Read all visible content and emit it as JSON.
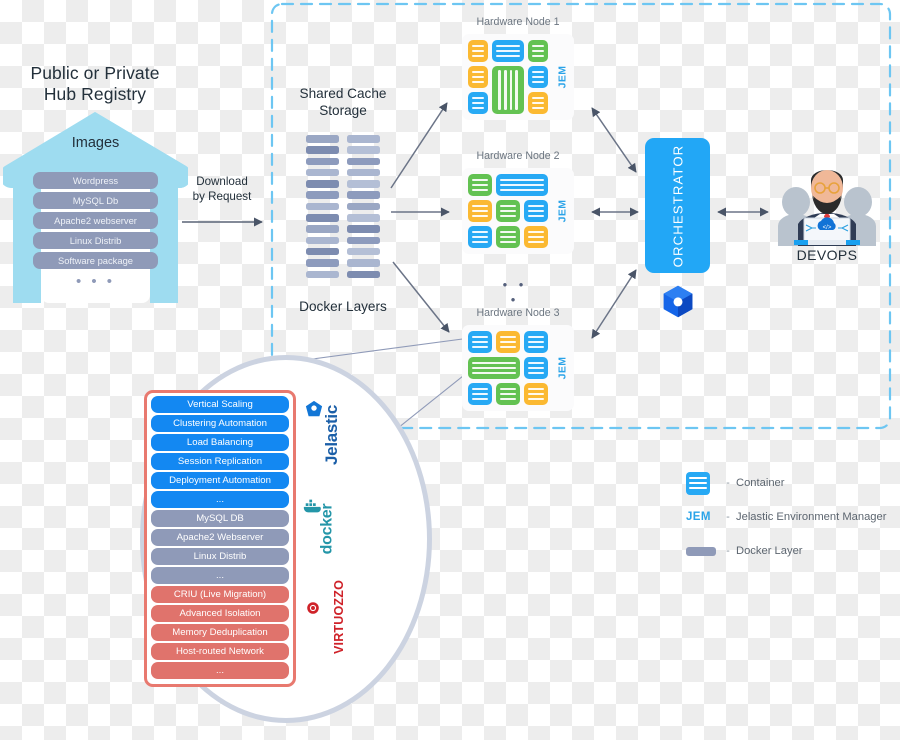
{
  "boundary": {
    "color": "#6dc6f2",
    "style": "dashed-rounded"
  },
  "hub": {
    "title": "Public or Private\nHub Registry",
    "title_line1": "Public or Private",
    "title_line2": "Hub Registry",
    "images_label": "Images",
    "items": [
      "Wordpress",
      "MySQL Db",
      "Apache2 webserver",
      "Linux Distrib",
      "Software package"
    ],
    "ellipsis": "• • •",
    "building_color": "#9edcf0",
    "item_color": "#8f9ab8"
  },
  "download": {
    "line1": "Download",
    "line2": "by Request"
  },
  "cache": {
    "title_line1": "Shared Cache",
    "title_line2": "Storage",
    "bottom_title": "Docker Layers",
    "column_left": [
      "#9aa7c4",
      "#7d8cb0",
      "#8d9bbd",
      "#aab6d0",
      "#7d8cb0",
      "#8d9bbd",
      "#aab6d0",
      "#7d8cb0",
      "#9aa7c4",
      "#aab6d0",
      "#7d8cb0",
      "#8d9bbd",
      "#aab6d0"
    ],
    "column_right": [
      "#aab6d0",
      "#b4bfd6",
      "#8d9bbd",
      "#aab6d0",
      "#b4bfd6",
      "#8d9bbd",
      "#9aa7c4",
      "#b4bfd6",
      "#7d8cb0",
      "#8d9bbd",
      "#b4bfd6",
      "#aab6d0",
      "#7d8cb0"
    ]
  },
  "nodes": [
    {
      "title": "Hardware Node 1",
      "jem": "JEM",
      "cells": [
        {
          "color": "orange",
          "col": "1 / 2",
          "row": "1 / 2",
          "lines": 3,
          "vert": false
        },
        {
          "color": "blue",
          "col": "2 / 3",
          "row": "1 / 2",
          "lines": 3,
          "vert": false
        },
        {
          "color": "green",
          "col": "3 / 4",
          "row": "1 / 2",
          "lines": 3,
          "vert": false
        },
        {
          "color": "orange",
          "col": "1 / 2",
          "row": "2 / 3",
          "lines": 3,
          "vert": false
        },
        {
          "color": "green",
          "col": "2 / 3",
          "row": "2 / 4",
          "lines": 4,
          "vert": true
        },
        {
          "color": "blue",
          "col": "3 / 4",
          "row": "2 / 3",
          "lines": 3,
          "vert": false
        },
        {
          "color": "blue",
          "col": "1 / 2",
          "row": "3 / 4",
          "lines": 3,
          "vert": false
        },
        {
          "color": "orange",
          "col": "3 / 4",
          "row": "3 / 4",
          "lines": 3,
          "vert": false
        }
      ]
    },
    {
      "title": "Hardware Node 2",
      "jem": "JEM",
      "cells": [
        {
          "color": "green",
          "col": "1 / 2",
          "row": "1 / 2",
          "lines": 3,
          "vert": false
        },
        {
          "color": "blue",
          "col": "2 / 4",
          "row": "1 / 2",
          "lines": 3,
          "vert": false
        },
        {
          "color": "orange",
          "col": "1 / 2",
          "row": "2 / 3",
          "lines": 3,
          "vert": false
        },
        {
          "color": "green",
          "col": "2 / 3",
          "row": "2 / 3",
          "lines": 3,
          "vert": false
        },
        {
          "color": "blue",
          "col": "3 / 4",
          "row": "2 / 3",
          "lines": 3,
          "vert": false
        },
        {
          "color": "blue",
          "col": "1 / 2",
          "row": "3 / 4",
          "lines": 3,
          "vert": false
        },
        {
          "color": "green",
          "col": "2 / 3",
          "row": "3 / 4",
          "lines": 3,
          "vert": false
        },
        {
          "color": "orange",
          "col": "3 / 4",
          "row": "3 / 4",
          "lines": 3,
          "vert": false
        }
      ]
    },
    {
      "title": "Hardware Node 3",
      "jem": "JEM",
      "cells": [
        {
          "color": "blue",
          "col": "1 / 2",
          "row": "1 / 2",
          "lines": 3,
          "vert": false
        },
        {
          "color": "orange",
          "col": "2 / 3",
          "row": "1 / 2",
          "lines": 3,
          "vert": false
        },
        {
          "color": "blue",
          "col": "3 / 4",
          "row": "1 / 2",
          "lines": 3,
          "vert": false
        },
        {
          "color": "green",
          "col": "1 / 3",
          "row": "2 / 3",
          "lines": 3,
          "vert": false
        },
        {
          "color": "blue",
          "col": "3 / 4",
          "row": "2 / 3",
          "lines": 3,
          "vert": false
        },
        {
          "color": "blue",
          "col": "1 / 2",
          "row": "3 / 4",
          "lines": 3,
          "vert": false
        },
        {
          "color": "green",
          "col": "2 / 3",
          "row": "3 / 4",
          "lines": 3,
          "vert": false
        },
        {
          "color": "orange",
          "col": "3 / 4",
          "row": "3 / 4",
          "lines": 3,
          "vert": false
        }
      ]
    }
  ],
  "node_ellipsis": "• • •",
  "orchestrator": {
    "label": "ORCHESTRATOR",
    "color": "#22a7f6"
  },
  "devops": {
    "label": "DEVOPS"
  },
  "magnifier": {
    "items": [
      {
        "label": "Vertical Scaling",
        "group": "jelastic"
      },
      {
        "label": "Clustering Automation",
        "group": "jelastic"
      },
      {
        "label": "Load Balancing",
        "group": "jelastic"
      },
      {
        "label": "Session Replication",
        "group": "jelastic"
      },
      {
        "label": "Deployment Automation",
        "group": "jelastic"
      },
      {
        "label": "...",
        "group": "jelastic"
      },
      {
        "label": "MySQL DB",
        "group": "docker"
      },
      {
        "label": "Apache2 Webserver",
        "group": "docker"
      },
      {
        "label": "Linux Distrib",
        "group": "docker"
      },
      {
        "label": "...",
        "group": "docker"
      },
      {
        "label": "CRIU (Live Migration)",
        "group": "virtuozzo"
      },
      {
        "label": "Advanced Isolation",
        "group": "virtuozzo"
      },
      {
        "label": "Memory Deduplication",
        "group": "virtuozzo"
      },
      {
        "label": "Host-routed Network",
        "group": "virtuozzo"
      },
      {
        "label": "...",
        "group": "virtuozzo"
      }
    ],
    "logos": [
      {
        "name": "Jelastic",
        "color": "#1b5fa8"
      },
      {
        "name": "docker",
        "color": "#2496a8"
      },
      {
        "name": "VIRTUOZZO",
        "color": "#cf2229"
      }
    ],
    "frame_color": "#e8796f"
  },
  "legend": {
    "separator": "-",
    "rows": [
      {
        "icon": "container-icon",
        "text": "Container"
      },
      {
        "icon": "jem-icon",
        "label": "JEM",
        "text": "Jelastic Environment Manager"
      },
      {
        "icon": "docker-layer-icon",
        "text": "Docker Layer"
      }
    ]
  }
}
